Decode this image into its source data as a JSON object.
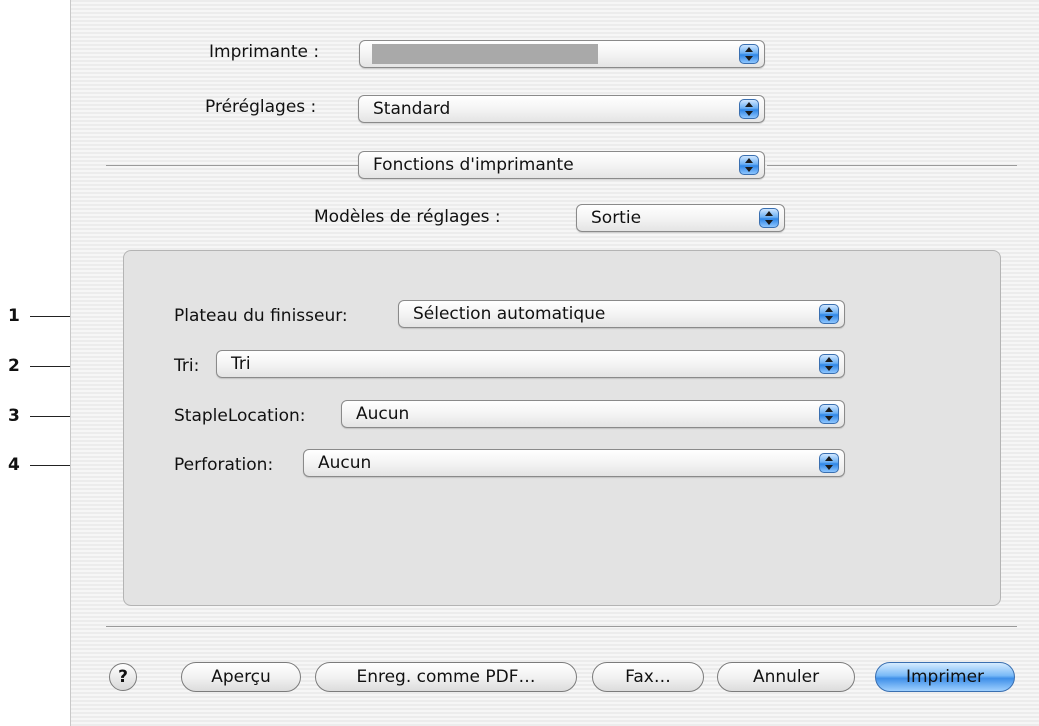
{
  "printer": {
    "label": "Imprimante :",
    "value": ""
  },
  "presets": {
    "label": "Préréglages :",
    "value": "Standard"
  },
  "panel": {
    "value": "Fonctions d'imprimante"
  },
  "settings_models": {
    "label": "Modèles de réglages :",
    "value": "Sortie"
  },
  "options": [
    {
      "label": "Plateau du finisseur:",
      "value": "Sélection automatique"
    },
    {
      "label": "Tri:",
      "value": "Tri"
    },
    {
      "label": "StapleLocation:",
      "value": "Aucun"
    },
    {
      "label": "Perforation:",
      "value": "Aucun"
    }
  ],
  "callouts": [
    "1",
    "2",
    "3",
    "4"
  ],
  "buttons": {
    "help": "?",
    "preview": "Aperçu",
    "save_pdf": "Enreg. comme PDF…",
    "fax": "Fax…",
    "cancel": "Annuler",
    "print": "Imprimer"
  },
  "colors": {
    "accent": "#3f8fe8",
    "dialog_bg": "#f0f0f0",
    "group_bg": "#e3e3e3"
  }
}
